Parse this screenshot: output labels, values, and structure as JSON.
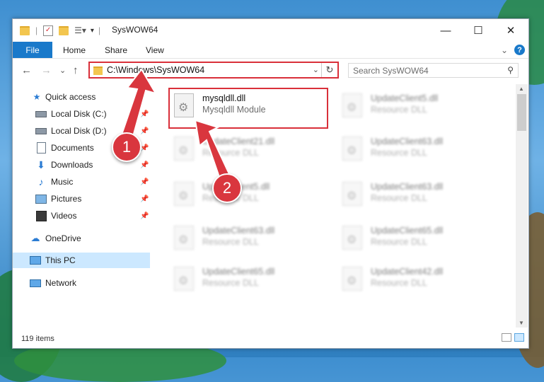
{
  "window": {
    "title": "SysWOW64",
    "controls": {
      "minimize": "—",
      "maximize": "☐",
      "close": "✕"
    }
  },
  "ribbon": {
    "tabs": [
      "File",
      "Home",
      "Share",
      "View"
    ],
    "help": "?",
    "expand": "⌄"
  },
  "navigation": {
    "back": "←",
    "forward": "→",
    "recent": "⌄",
    "up": "↑",
    "address": "C:\\Windows\\SysWOW64",
    "refresh": "↻",
    "dropdown": "⌄",
    "search_placeholder": "Search SysWOW64"
  },
  "nav_pane": {
    "items": [
      {
        "label": "Quick access",
        "icon": "star-icon"
      },
      {
        "label": "Local Disk (C:)",
        "icon": "drive-icon",
        "pinned": true
      },
      {
        "label": "Local Disk (D:)",
        "icon": "drive-icon",
        "pinned": true
      },
      {
        "label": "Documents",
        "icon": "documents-icon",
        "pinned": true
      },
      {
        "label": "Downloads",
        "icon": "download-icon",
        "pinned": true
      },
      {
        "label": "Music",
        "icon": "music-icon",
        "pinned": true
      },
      {
        "label": "Pictures",
        "icon": "pictures-icon",
        "pinned": true
      },
      {
        "label": "Videos",
        "icon": "videos-icon",
        "pinned": true
      },
      {
        "label": "OneDrive",
        "icon": "cloud-icon"
      },
      {
        "label": "This PC",
        "icon": "computer-icon",
        "selected": true
      },
      {
        "label": "Network",
        "icon": "network-icon"
      }
    ]
  },
  "files": [
    {
      "name": "mysqldll.dll",
      "desc": "Mysqldll Module",
      "highlighted": true
    },
    {
      "name": "UpdateClient5.dll",
      "desc": "Resource DLL"
    },
    {
      "name": "UpdateClient21.dll",
      "desc": "Resource DLL"
    },
    {
      "name": "UpdateClient63.dll",
      "desc": "Resource DLL"
    },
    {
      "name": "UpdateClient5.dll",
      "desc": "Resource DLL"
    },
    {
      "name": "UpdateClient63.dll",
      "desc": "Resource DLL"
    },
    {
      "name": "UpdateClient63.dll",
      "desc": "Resource DLL"
    },
    {
      "name": "UpdateClient65.dll",
      "desc": "Resource DLL"
    },
    {
      "name": "UpdateClient65.dll",
      "desc": "Resource DLL"
    },
    {
      "name": "UpdateClient42.dll",
      "desc": "Resource DLL"
    }
  ],
  "status": {
    "item_count": "119 items"
  },
  "annotations": {
    "step1": "1",
    "step2": "2",
    "color": "#d9363e"
  }
}
